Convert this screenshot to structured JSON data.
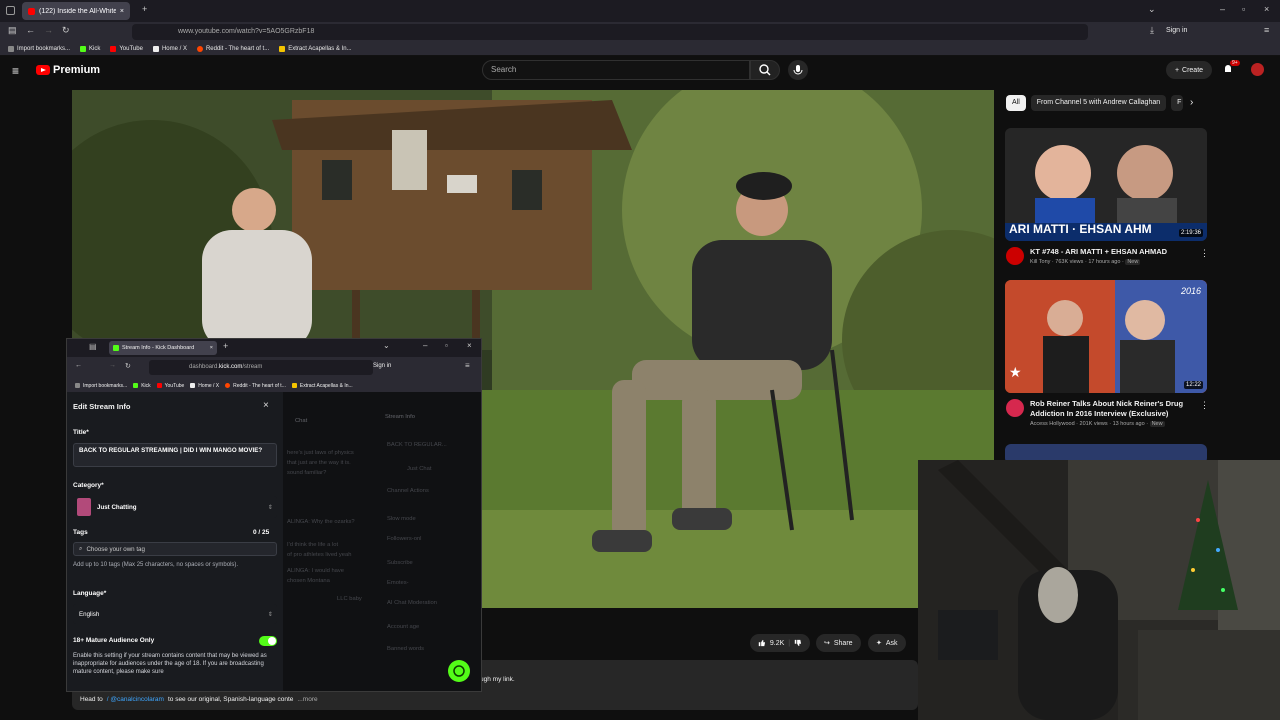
{
  "browser": {
    "tab_title": "(122) Inside the All-White C",
    "url": "www.youtube.com/watch?v=5AO5GRzbF18",
    "sign_in": "Sign in",
    "bookmarks": [
      "Import bookmarks...",
      "Kick",
      "YouTube",
      "Home / X",
      "Reddit - The heart of t...",
      "Extract Acapellas & In..."
    ]
  },
  "youtube": {
    "logo_text": "Premium",
    "search_placeholder": "Search",
    "create_label": "Create",
    "notif_count": "9+",
    "actions": {
      "likes": "9.2K",
      "share": "Share",
      "ask": "Ask"
    },
    "description_snippet": "ugh my link.",
    "description_footer": {
      "prefix": "Head to",
      "handle": "/ @canalcincolaram",
      "suffix": "to see our original, Spanish-language conte",
      "more": "...more"
    },
    "chips": [
      "All",
      "From Channel 5 with Andrew Callaghan",
      "F"
    ],
    "recommendations": [
      {
        "thumb_text": "ARI MATTI · EHSAN AHM",
        "duration": "2:19:36",
        "title": "KT #748 - ARI MATTI + EHSAN AHMAD",
        "channel": "Kill Tony",
        "views": "763K views",
        "age": "17 hours ago",
        "badge": "New"
      },
      {
        "thumb_text": "2016",
        "duration": "12:22",
        "title": "Rob Reiner Talks About Nick Reiner's Drug Addiction In 2016 Interview (Exclusive)",
        "channel": "Access Hollywood",
        "views": "201K views",
        "age": "13 hours ago",
        "badge": "New"
      }
    ]
  },
  "kick": {
    "tab_title": "Stream Info - Kick Dashboard",
    "url_prefix": "dashboard.",
    "url_domain": "kick.com",
    "url_path": "/stream",
    "sign_in": "Sign in",
    "bookmarks": [
      "Import bookmarks...",
      "Kick",
      "YouTube",
      "Home / X",
      "Reddit - The heart of t...",
      "Extract Acapellas & In..."
    ],
    "modal": {
      "heading": "Edit Stream Info",
      "title_label": "Title*",
      "title_value": "BACK TO REGULAR STREAMING | DID I WIN MANGO MOVIE?",
      "category_label": "Category*",
      "category_value": "Just Chatting",
      "tags_label": "Tags",
      "tags_count": "0 / 25",
      "tags_placeholder": "Choose your own tag",
      "tags_help": "Add up to 10 tags (Max 25 characters, no spaces or symbols).",
      "language_label": "Language*",
      "language_value": "English",
      "mature_label": "18+ Mature Audience Only",
      "mature_on": true,
      "mature_help": "Enable this setting if your stream contains content that may be viewed as inappropriate for audiences under the age of 18. If you are broadcasting mature content, please make sure"
    },
    "background": {
      "chat_header": "Chat",
      "stream_info": "Stream Info",
      "lines": [
        "here's just laws of physics",
        "that just are the way it is.",
        "sound familiar?",
        "ALINGA: Why the ozarks?",
        "I'd think the life a lot",
        "of pro athletes lived yeah",
        "ALINGA: I would have",
        "chosen Montana",
        "LLC baby"
      ],
      "panel_items": [
        "BACK TO REGULAR...",
        "Just Chat",
        "Channel Actions",
        "Slow mode",
        "Followers-onl",
        "Subscribe",
        "Emotes-",
        "AI Chat Moderation",
        "Account age",
        "Banned words"
      ]
    }
  },
  "colors": {
    "yt_red": "#ff0000",
    "kick_green": "#53fc18",
    "yt_bg": "#0f0f0f"
  }
}
